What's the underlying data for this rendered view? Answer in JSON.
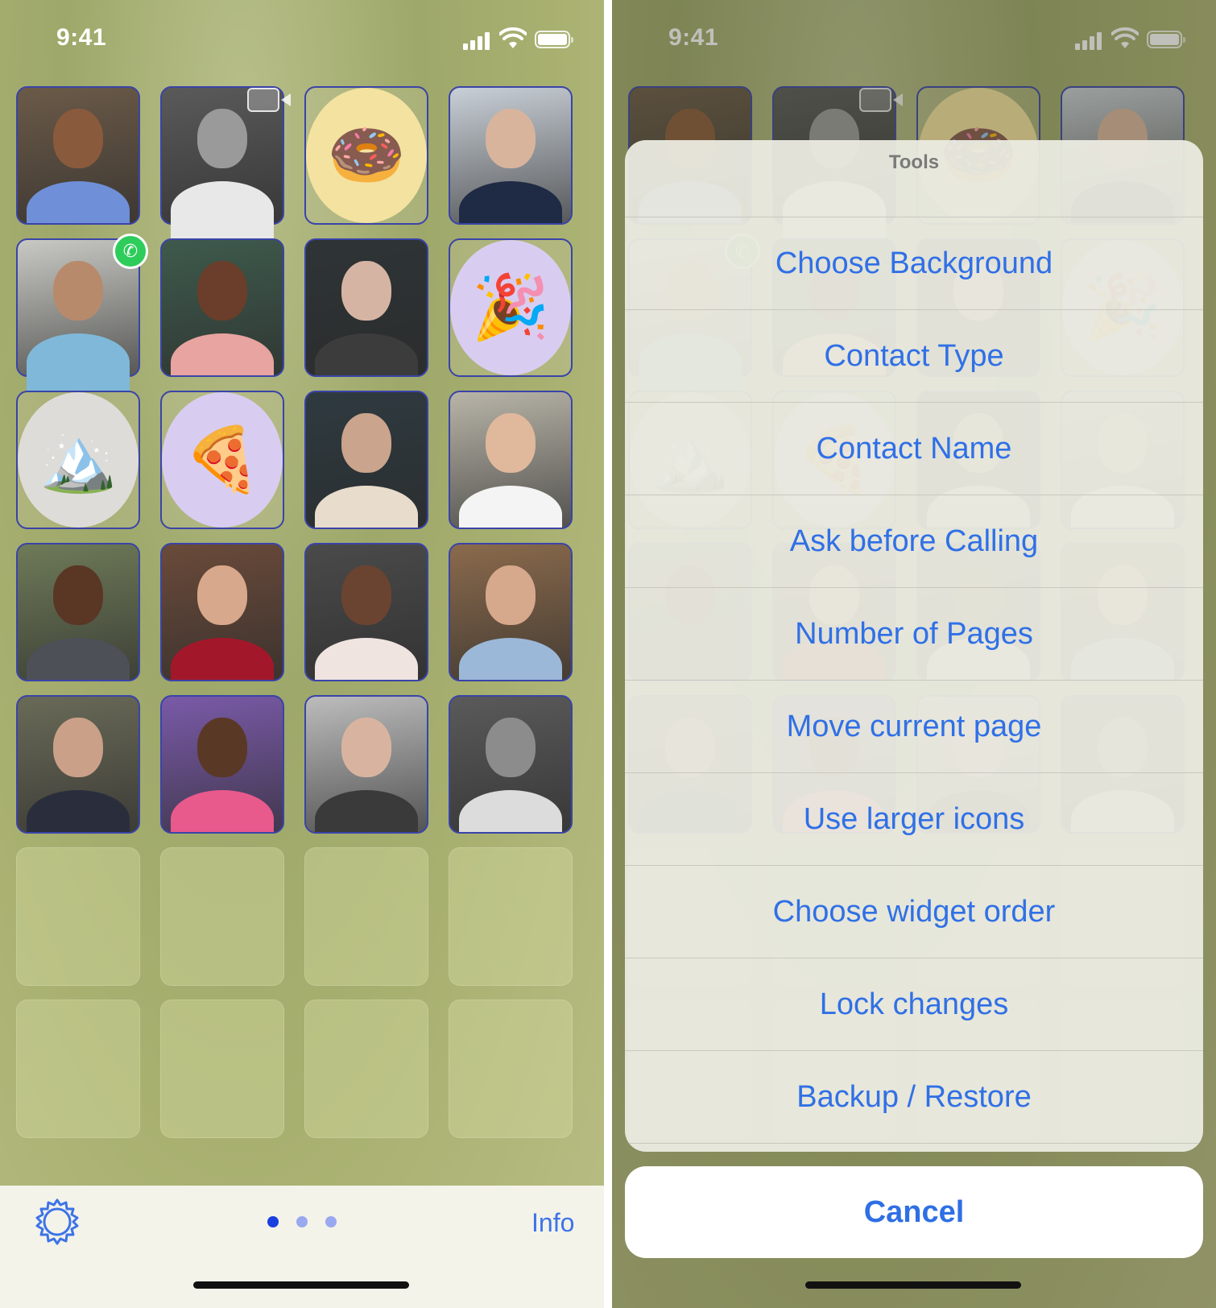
{
  "status_bar": {
    "time": "9:41"
  },
  "left_screen": {
    "contacts_grid": {
      "tiles": [
        {
          "kind": "photo",
          "skin": "#8a5a3c",
          "shirt": "#6f8fd8",
          "bg": "#6b5a48"
        },
        {
          "kind": "photo",
          "skin": "#9a9a9a",
          "shirt": "#e8e8e8",
          "bg": "#5a5a5a",
          "badge": "video-camera-icon"
        },
        {
          "kind": "emoji",
          "emoji": "🍩",
          "circle": "#f4e2a0"
        },
        {
          "kind": "photo",
          "skin": "#d8b49c",
          "shirt": "#1f2a44",
          "bg": "#c8cfd6"
        },
        {
          "kind": "photo",
          "skin": "#b88a6c",
          "shirt": "#7fb8d8",
          "bg": "#c9c9c4",
          "badge": "whatsapp-icon"
        },
        {
          "kind": "photo",
          "skin": "#6a3e2a",
          "shirt": "#e7a4a0",
          "bg": "#3e5a4c"
        },
        {
          "kind": "photo",
          "skin": "#d6b4a4",
          "shirt": "#3c3c3c",
          "bg": "#2e3436"
        },
        {
          "kind": "emoji",
          "emoji": "🎉",
          "circle": "#d8cdf0"
        },
        {
          "kind": "emoji",
          "emoji": "🏔️",
          "circle": "#dedcd8"
        },
        {
          "kind": "emoji",
          "emoji": "🍕",
          "circle": "#d8cdf0"
        },
        {
          "kind": "photo",
          "skin": "#caa48c",
          "shirt": "#e8dccc",
          "bg": "#2e3a40"
        },
        {
          "kind": "photo",
          "skin": "#e0b89c",
          "shirt": "#f4f4f4",
          "bg": "#b8b4a8"
        },
        {
          "kind": "photo",
          "skin": "#5a3624",
          "shirt": "#4e5058",
          "bg": "#6e7a58"
        },
        {
          "kind": "photo",
          "skin": "#d8a88c",
          "shirt": "#a2182a",
          "bg": "#6a4a3a"
        },
        {
          "kind": "photo",
          "skin": "#6a4430",
          "shirt": "#f0e4e0",
          "bg": "#4a4a4a"
        },
        {
          "kind": "photo",
          "skin": "#d6a88c",
          "shirt": "#9cb8d8",
          "bg": "#8a6a4c"
        },
        {
          "kind": "photo",
          "skin": "#caa088",
          "shirt": "#2a2e3c",
          "bg": "#6a6a58"
        },
        {
          "kind": "photo",
          "skin": "#5a3826",
          "shirt": "#e85a8c",
          "bg": "#7a5aa8"
        },
        {
          "kind": "photo",
          "skin": "#d8b4a0",
          "shirt": "#3a3a3a",
          "bg": "#bcbcbc"
        },
        {
          "kind": "photo",
          "skin": "#8c8c8c",
          "shirt": "#dcdcdc",
          "bg": "#5a5a5a"
        },
        {
          "kind": "empty"
        },
        {
          "kind": "empty"
        },
        {
          "kind": "empty"
        },
        {
          "kind": "empty"
        },
        {
          "kind": "empty"
        },
        {
          "kind": "empty"
        },
        {
          "kind": "empty"
        },
        {
          "kind": "empty"
        }
      ]
    },
    "bottom_bar": {
      "settings_icon": "gear-icon",
      "page_dots": [
        {
          "active": true,
          "color": "#1a3fe0"
        },
        {
          "active": false,
          "color": "#9aa8f0"
        },
        {
          "active": false,
          "color": "#9aa8f0"
        }
      ],
      "info_label": "Info"
    }
  },
  "right_screen": {
    "action_sheet": {
      "title": "Tools",
      "items": [
        "Choose Background",
        "Contact Type",
        "Contact Name",
        "Ask before Calling",
        "Number of Pages",
        "Move current page",
        "Use larger icons",
        "Choose widget order",
        "Lock changes",
        "Backup / Restore"
      ],
      "cancel_label": "Cancel"
    }
  },
  "colors": {
    "accent_blue": "#3070e6",
    "tile_border": "#3a44a8"
  }
}
